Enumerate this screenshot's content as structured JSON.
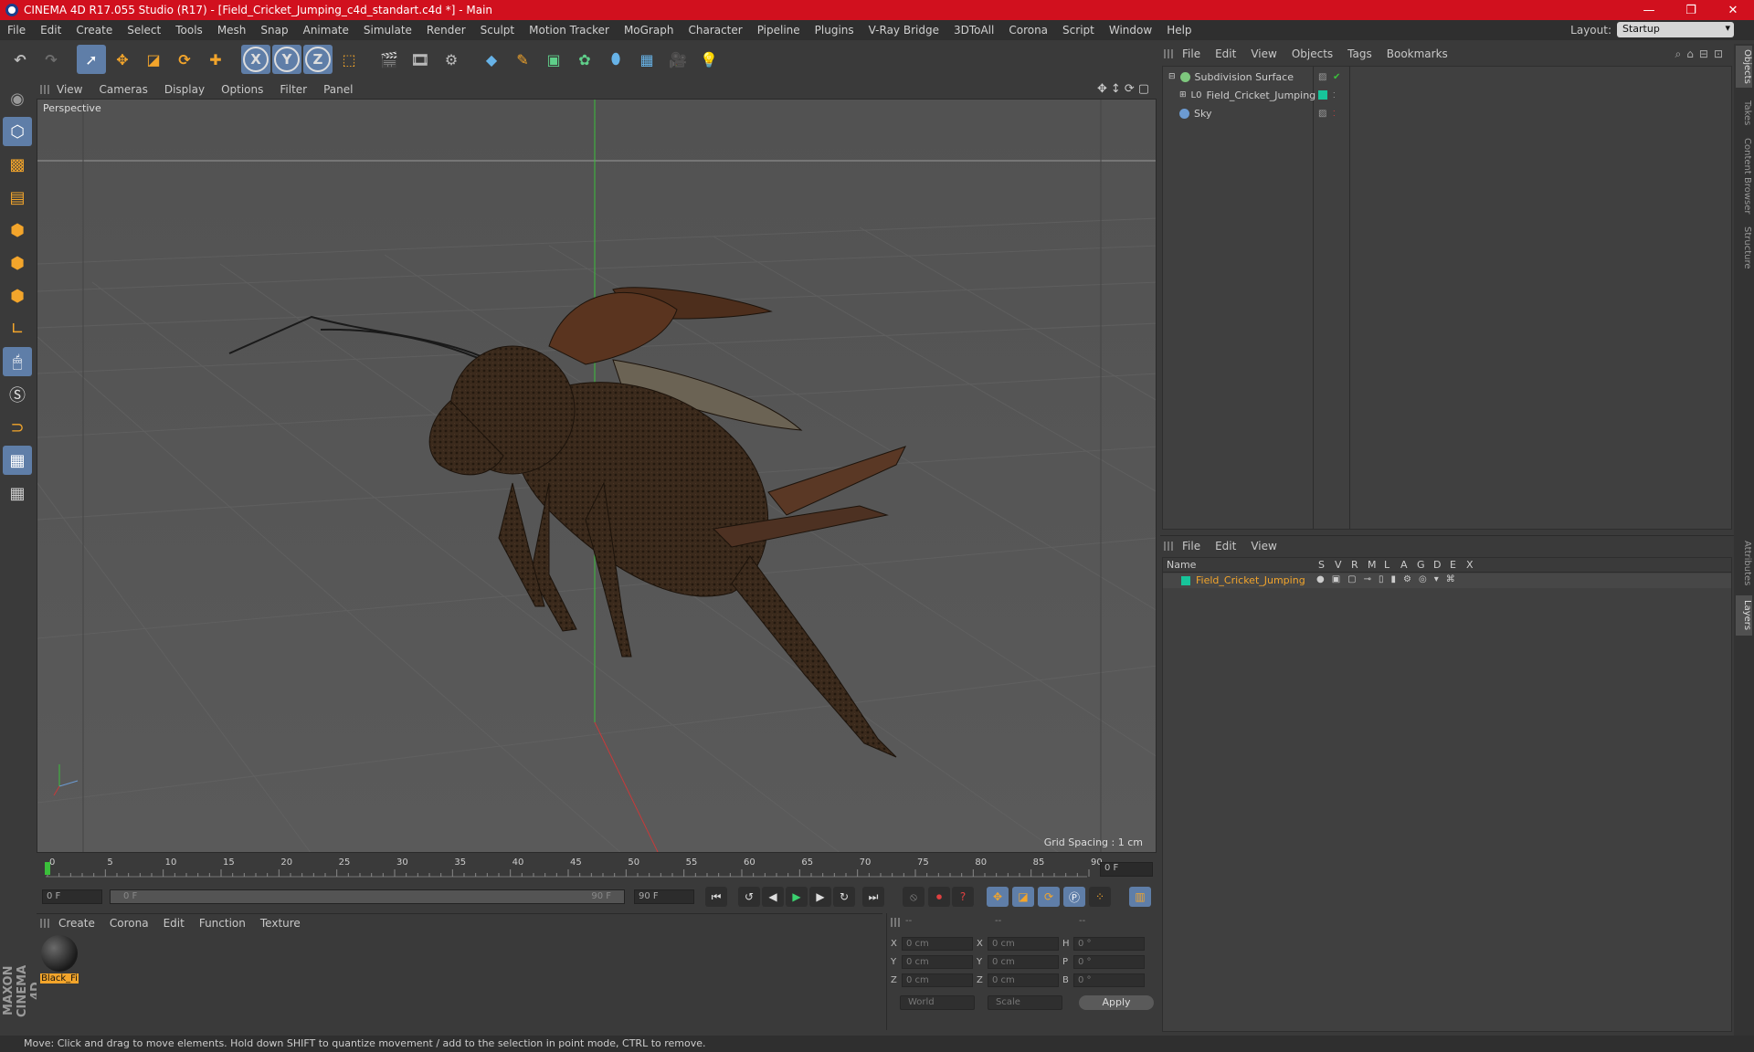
{
  "window": {
    "title": "CINEMA 4D R17.055 Studio (R17) - [Field_Cricket_Jumping_c4d_standart.c4d *] - Main"
  },
  "menubar": {
    "items": [
      "File",
      "Edit",
      "Create",
      "Select",
      "Tools",
      "Mesh",
      "Snap",
      "Animate",
      "Simulate",
      "Render",
      "Sculpt",
      "Motion Tracker",
      "MoGraph",
      "Character",
      "Pipeline",
      "Plugins",
      "V-Ray Bridge",
      "3DToAll",
      "Corona",
      "Script",
      "Window",
      "Help"
    ],
    "layout_label": "Layout:",
    "layout_value": "Startup"
  },
  "toolbar": {
    "undo_icon": "undo-icon",
    "axis_x": "X",
    "axis_y": "Y",
    "axis_z": "Z"
  },
  "viewport": {
    "menu": [
      "View",
      "Cameras",
      "Display",
      "Options",
      "Filter",
      "Panel"
    ],
    "label": "Perspective",
    "grid_spacing": "Grid Spacing : 1 cm"
  },
  "timeline": {
    "ticks": [
      "0",
      "5",
      "10",
      "15",
      "20",
      "25",
      "30",
      "35",
      "40",
      "45",
      "50",
      "55",
      "60",
      "65",
      "70",
      "75",
      "80",
      "85",
      "90"
    ],
    "current": "0 F",
    "start": "0 F",
    "range_start": "0 F",
    "range_end": "90 F",
    "end": "90 F"
  },
  "materials": {
    "menu": [
      "Create",
      "Corona",
      "Edit",
      "Function",
      "Texture"
    ],
    "items": [
      {
        "label": "Black_Fi"
      }
    ]
  },
  "coordinates": {
    "headers": [
      "--",
      "--",
      "--"
    ],
    "rows": [
      {
        "a": "X",
        "av": "0 cm",
        "b": "X",
        "bv": "0 cm",
        "c": "H",
        "cv": "0 °"
      },
      {
        "a": "Y",
        "av": "0 cm",
        "b": "Y",
        "bv": "0 cm",
        "c": "P",
        "cv": "0 °"
      },
      {
        "a": "Z",
        "av": "0 cm",
        "b": "Z",
        "bv": "0 cm",
        "c": "B",
        "cv": "0 °"
      }
    ],
    "mode": "World",
    "scale": "Scale",
    "apply": "Apply"
  },
  "objects": {
    "menu": [
      "File",
      "Edit",
      "View",
      "Objects",
      "Tags",
      "Bookmarks"
    ],
    "rows": [
      {
        "name": "Subdivision Surface",
        "color": "#7ec87e"
      },
      {
        "name": "Field_Cricket_Jumping",
        "color": "#17c49a"
      },
      {
        "name": "Sky",
        "color": "#6c9bd2"
      }
    ]
  },
  "layers": {
    "menu": [
      "File",
      "Edit",
      "View"
    ],
    "headers": [
      "Name",
      "S",
      "V",
      "R",
      "M",
      "L",
      "A",
      "G",
      "D",
      "E",
      "X"
    ],
    "rows": [
      {
        "name": "Field_Cricket_Jumping",
        "color": "#17c49a"
      }
    ]
  },
  "right_tabs": [
    "Objects",
    "Takes",
    "Content Browser",
    "Structure",
    "Attributes",
    "Layers"
  ],
  "status": {
    "text": "Move: Click and drag to move elements. Hold down SHIFT to quantize movement / add to the selection in point mode, CTRL to remove."
  },
  "brand": {
    "text": "MAXON CINEMA 4D"
  },
  "colors": {
    "accent": "#f3a52b",
    "active": "#5f7ea8",
    "titlebar": "#d1101e"
  }
}
